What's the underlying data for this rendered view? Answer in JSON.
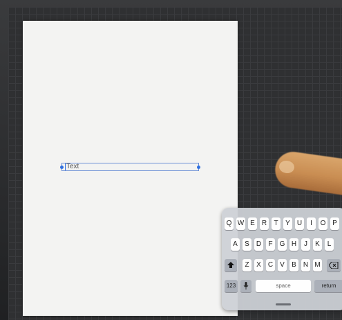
{
  "document": {
    "text_field_value": "Text"
  },
  "keyboard": {
    "row1": [
      "Q",
      "W",
      "E",
      "R",
      "T",
      "Y",
      "U",
      "I",
      "O",
      "P"
    ],
    "row2": [
      "A",
      "S",
      "D",
      "F",
      "G",
      "H",
      "J",
      "K",
      "L"
    ],
    "row3": [
      "Z",
      "X",
      "C",
      "V",
      "B",
      "N",
      "M"
    ],
    "shift_icon": "shift-arrow-icon",
    "delete_icon": "delete-backspace-icon",
    "numbers_label": "123",
    "mic_icon": "microphone-icon",
    "space_label": "space",
    "return_label": "return"
  },
  "colors": {
    "selection_blue": "#2f6fe0",
    "keyboard_bg": "#cdd0d6",
    "key_light": "#fefefe",
    "key_dark": "#abb0b9"
  }
}
